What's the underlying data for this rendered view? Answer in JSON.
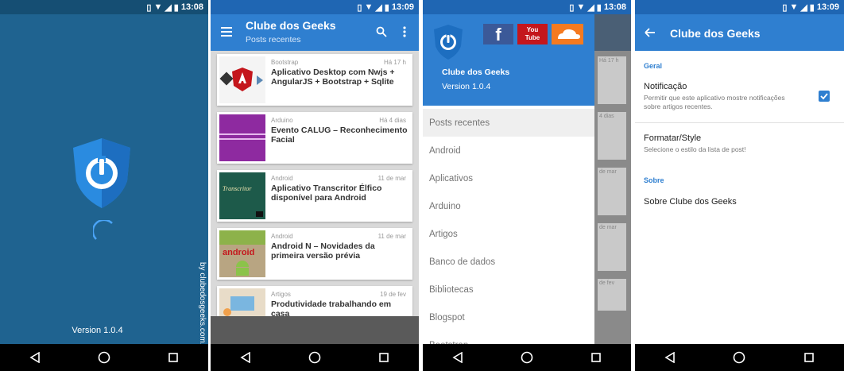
{
  "status": {
    "splash_time": "13:08",
    "list_time": "13:09",
    "drawer_time": "13:08",
    "settings_time": "13:09"
  },
  "splash": {
    "version": "Version 1.0.4",
    "credit": "by clubedosgeeks.com.br"
  },
  "list": {
    "title": "Clube dos Geeks",
    "subtitle": "Posts recentes",
    "cards": [
      {
        "category": "Bootstrap",
        "time": "Há 17 h",
        "title": "Aplicativo Desktop com Nwjs + AngularJS + Bootstrap + Sqlite"
      },
      {
        "category": "Arduino",
        "time": "Há 4 dias",
        "title": "Evento CALUG – Reconhecimento Facial"
      },
      {
        "category": "Android",
        "time": "11 de mar",
        "title": "Aplicativo Transcritor Élfico disponível para Android"
      },
      {
        "category": "Android",
        "time": "11 de mar",
        "title": "Android N – Novidades da primeira versão prévia"
      },
      {
        "category": "Artigos",
        "time": "19 de fev",
        "title": "Produtividade trabalhando em casa"
      }
    ],
    "thumb_texts": {
      "transcritor": "Transcritor",
      "android": "android"
    }
  },
  "drawer": {
    "app_name": "Clube dos Geeks",
    "version": "Version 1.0.4",
    "social": {
      "facebook": "f",
      "youtube_top": "You",
      "youtube_bottom": "Tube"
    },
    "items": [
      "Posts recentes",
      "Android",
      "Aplicativos",
      "Arduino",
      "Artigos",
      "Banco de dados",
      "Bibliotecas",
      "Blogspot",
      "Bootstrap"
    ],
    "behind_times": [
      "Há 17 h",
      "4 dias",
      "de mar",
      "de mar",
      "de fev"
    ]
  },
  "settings": {
    "title": "Clube dos Geeks",
    "section_general": "Geral",
    "notif_title": "Notificação",
    "notif_desc": "Permitir que este aplicativo mostre notificações sobre artigos recentes.",
    "notif_checked": true,
    "format_title": "Formatar/Style",
    "format_desc": "Selecione o estilo da lista de post!",
    "section_about": "Sobre",
    "about_title": "Sobre Clube dos Geeks"
  },
  "colors": {
    "primary": "#2f7fd0",
    "splash_bg": "#1f6390",
    "accent_red": "#c4161c"
  }
}
